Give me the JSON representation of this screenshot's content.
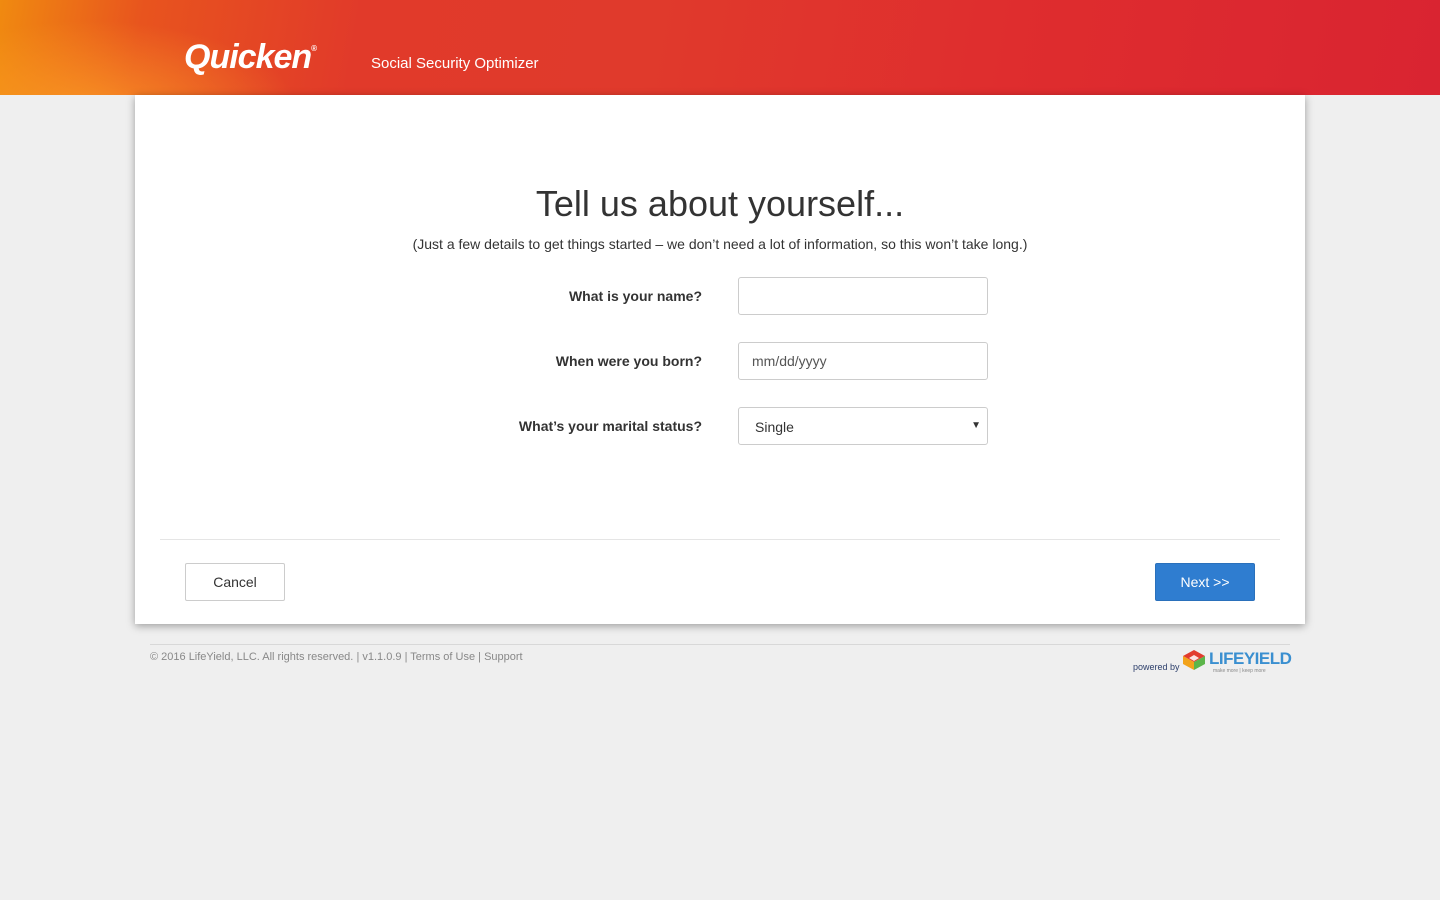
{
  "header": {
    "logo_text": "Quicken",
    "logo_mark": "®",
    "app_title": "Social Security Optimizer"
  },
  "form": {
    "title": "Tell us about yourself...",
    "subtitle": "(Just a few details to get things started – we don’t need a lot of information, so this won’t take long.)",
    "name_label": "What is your name?",
    "name_value": "",
    "name_placeholder": "",
    "dob_label": "When were you born?",
    "dob_placeholder": "mm/dd/yyyy",
    "marital_label": "What’s your marital status?",
    "marital_value": "Single"
  },
  "actions": {
    "cancel_label": "Cancel",
    "next_label": "Next >>"
  },
  "footer": {
    "copyright": "© 2016 LifeYield, LLC. All rights reserved.",
    "separator": "|",
    "version": "v1.1.0.9",
    "terms_label": "Terms of Use",
    "support_label": "Support",
    "powered_by": "powered by",
    "brand_name": "LIFEYIELD",
    "brand_tagline": "make more | keep more"
  },
  "colors": {
    "header_red": "#e03a2c",
    "header_orange": "#f08a10",
    "next_button": "#2f7dd0",
    "background": "#efefef"
  }
}
